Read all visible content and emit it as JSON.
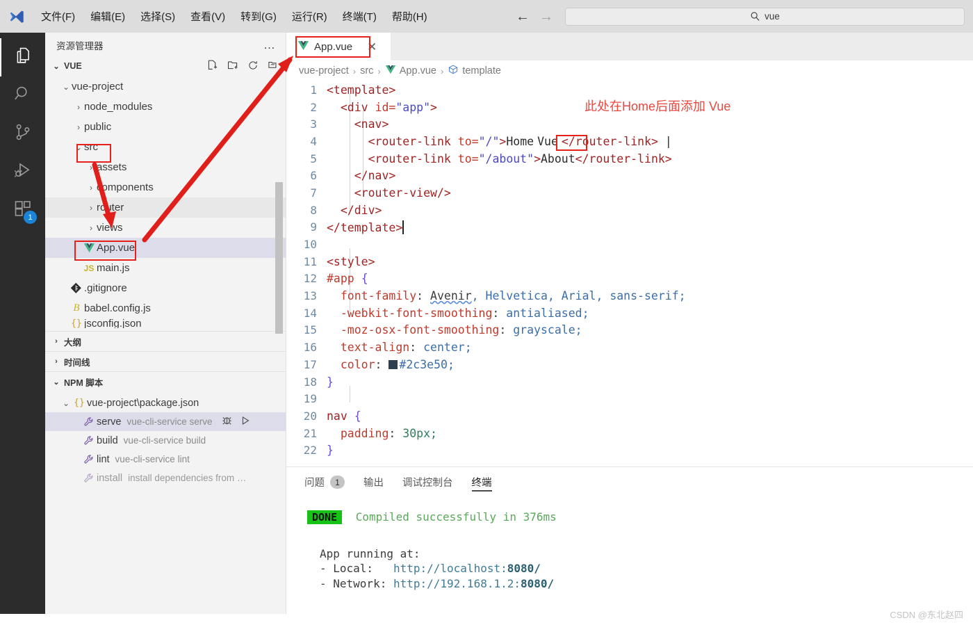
{
  "titlebar": {
    "logo_icon": "vscode-logo-icon",
    "menus": [
      "文件(F)",
      "编辑(E)",
      "选择(S)",
      "查看(V)",
      "转到(G)",
      "运行(R)",
      "终端(T)",
      "帮助(H)"
    ],
    "back_icon": "arrow-left-icon",
    "forward_icon": "arrow-right-icon",
    "search": {
      "icon": "search-icon",
      "value": "vue",
      "placeholder": "vue"
    }
  },
  "activitybar": {
    "items": [
      {
        "name": "explorer",
        "icon": "files-icon",
        "active": true,
        "badge": ""
      },
      {
        "name": "search",
        "icon": "search-icon",
        "active": false,
        "badge": ""
      },
      {
        "name": "source-control",
        "icon": "source-control-icon",
        "active": false,
        "badge": ""
      },
      {
        "name": "run-debug",
        "icon": "run-debug-icon",
        "active": false,
        "badge": ""
      },
      {
        "name": "extensions",
        "icon": "extensions-icon",
        "active": false,
        "badge": "1"
      }
    ]
  },
  "sidebar": {
    "title": "资源管理器",
    "more_actions": "…",
    "root": {
      "label": "VUE",
      "chevron": "⌄",
      "toolbar": [
        "new-file-icon",
        "new-folder-icon",
        "refresh-icon",
        "collapse-all-icon"
      ]
    },
    "tree": [
      {
        "label": "vue-project",
        "arrow": "⌄",
        "icon": "",
        "indent": 1,
        "state": "normal"
      },
      {
        "label": "node_modules",
        "arrow": "›",
        "icon": "",
        "indent": 2,
        "state": "normal"
      },
      {
        "label": "public",
        "arrow": "›",
        "icon": "",
        "indent": 2,
        "state": "normal"
      },
      {
        "label": "src",
        "arrow": "⌄",
        "icon": "",
        "indent": 2,
        "state": "normal"
      },
      {
        "label": "assets",
        "arrow": "›",
        "icon": "",
        "indent": 3,
        "state": "normal"
      },
      {
        "label": "components",
        "arrow": "›",
        "icon": "",
        "indent": 3,
        "state": "normal"
      },
      {
        "label": "router",
        "arrow": "›",
        "icon": "",
        "indent": 3,
        "state": "hovered"
      },
      {
        "label": "views",
        "arrow": "›",
        "icon": "",
        "indent": 3,
        "state": "normal"
      },
      {
        "label": "App.vue",
        "arrow": "",
        "icon": "vue-file-icon",
        "indent": 3,
        "state": "selected"
      },
      {
        "label": "main.js",
        "arrow": "",
        "icon": "js-file-icon",
        "indent": 3,
        "state": "normal"
      },
      {
        "label": ".gitignore",
        "arrow": "",
        "icon": "git-file-icon",
        "indent": 2,
        "state": "normal"
      },
      {
        "label": "babel.config.js",
        "arrow": "",
        "icon": "babel-file-icon",
        "indent": 2,
        "state": "normal"
      },
      {
        "label": "jsconfig.json",
        "arrow": "",
        "icon": "json-file-icon",
        "indent": 2,
        "state": "normal"
      }
    ],
    "panes": [
      {
        "label": "大纲",
        "chevron": "›"
      },
      {
        "label": "时间线",
        "chevron": "›"
      }
    ],
    "npm": {
      "label": "NPM 脚本",
      "chevron": "⌄",
      "package": {
        "label": "vue-project\\package.json",
        "chevron": "⌄",
        "icon": "json-braces-icon"
      },
      "scripts": [
        {
          "name": "serve",
          "command": "vue-cli-service serve",
          "icon": "wrench-icon",
          "selected": true,
          "actions": [
            "debug-icon",
            "run-icon"
          ]
        },
        {
          "name": "build",
          "command": "vue-cli-service build",
          "icon": "wrench-icon",
          "selected": false,
          "actions": []
        },
        {
          "name": "lint",
          "command": "vue-cli-service lint",
          "icon": "wrench-icon",
          "selected": false,
          "actions": []
        },
        {
          "name": "install",
          "command": "install dependencies from …",
          "icon": "wrench-icon",
          "selected": false,
          "actions": []
        }
      ]
    }
  },
  "editor": {
    "tab": {
      "label": "App.vue",
      "icon": "vue-file-icon",
      "close_icon": "close-icon"
    },
    "breadcrumbs": [
      {
        "label": "vue-project",
        "icon": ""
      },
      {
        "label": "src",
        "icon": ""
      },
      {
        "label": "App.vue",
        "icon": "vue-file-icon"
      },
      {
        "label": "template",
        "icon": "symbol-template-icon"
      }
    ],
    "breadcrumb_separator": "›",
    "lines": [
      {
        "n": "1",
        "indent": 0
      },
      {
        "n": "2",
        "indent": 0
      },
      {
        "n": "3",
        "indent": 0
      },
      {
        "n": "4",
        "indent": 0
      },
      {
        "n": "5",
        "indent": 0
      },
      {
        "n": "6",
        "indent": 0
      },
      {
        "n": "7",
        "indent": 0
      },
      {
        "n": "8",
        "indent": 0
      },
      {
        "n": "9",
        "indent": 0
      },
      {
        "n": "10",
        "indent": 0
      },
      {
        "n": "11",
        "indent": 0
      },
      {
        "n": "12",
        "indent": 0
      },
      {
        "n": "13",
        "indent": 0
      },
      {
        "n": "14",
        "indent": 0
      },
      {
        "n": "15",
        "indent": 0
      },
      {
        "n": "16",
        "indent": 0
      },
      {
        "n": "17",
        "indent": 0
      },
      {
        "n": "18",
        "indent": 0
      },
      {
        "n": "19",
        "indent": 0
      },
      {
        "n": "20",
        "indent": 0
      },
      {
        "n": "21",
        "indent": 0
      },
      {
        "n": "22",
        "indent": 0
      }
    ],
    "code": {
      "l1": "<template>",
      "l2": "  <div id=\"app\">",
      "l3": "    <nav>",
      "l4": "      <router-link to=\"/\">Home Vue</router-link> |",
      "l5": "      <router-link to=\"/about\">About</router-link>",
      "l6": "    </nav>",
      "l7": "    <router-view/>",
      "l8": "  </div>",
      "l9": "</template>",
      "l11": "<style>",
      "l12": "#app {",
      "l13": "  font-family: Avenir, Helvetica, Arial, sans-serif;",
      "l14": "  -webkit-font-smoothing: antialiased;",
      "l15": "  -moz-osx-font-smoothing: grayscale;",
      "l16": "  text-align: center;",
      "l17": "  color: #2c3e50;",
      "l18": "}",
      "l20": "nav {",
      "l21": "  padding: 30px;",
      "l22": "}",
      "tokens": {
        "template_open": "<template>",
        "template_close": "</template>",
        "div_open": "<div",
        "attr_id": "id=",
        "val_app": "\"app\"",
        "gt": ">",
        "nav_open": "<nav>",
        "nav_close": "</nav>",
        "div_close": "</div>",
        "router_link_open": "<router-link",
        "attr_to": "to=",
        "val_slash": "\"/\"",
        "val_about": "\"/about\"",
        "text_home": "Home",
        "text_vue": "Vue",
        "text_about": "About",
        "router_link_close": "</router-link>",
        "pipe": "|",
        "router_view": "<router-view/>",
        "style_open": "<style>",
        "sel_app": "#app",
        "brace_open": "{",
        "brace_close": "}",
        "p_fontfamily": "font-family",
        "v_avenir": "Avenir",
        "v_fontrest": ", Helvetica, Arial, sans-serif;",
        "p_webkit": "-webkit-font-smoothing",
        "v_antialiased": "antialiased;",
        "p_moz": "-moz-osx-font-smoothing",
        "v_grayscale": "grayscale;",
        "p_textalign": "text-align",
        "v_center": "center;",
        "p_color": "color",
        "v_hex": "#2c3e50;",
        "sel_nav": "nav",
        "p_padding": "padding",
        "v_30px": "30px;",
        "colon": ":"
      },
      "color_swatch": "#2c3e50"
    }
  },
  "panel": {
    "tabs": [
      {
        "label": "问题",
        "badge": "1",
        "active": false
      },
      {
        "label": "输出",
        "badge": "",
        "active": false
      },
      {
        "label": "调试控制台",
        "badge": "",
        "active": false
      },
      {
        "label": "终端",
        "badge": "",
        "active": true
      }
    ],
    "terminal": {
      "status_badge": "DONE",
      "status_message": "Compiled successfully in 376ms",
      "running_title": "App running at:",
      "local_label": "- Local:   ",
      "local_url_base": "http://localhost:",
      "local_port": "8080/",
      "network_label": "- Network: ",
      "network_url_base": "http://192.168.1.2:",
      "network_port": "8080/"
    }
  },
  "annotations": {
    "note": "此处在Home后面添加 Vue",
    "note_color": "#e8473f",
    "box_color": "#e8201a",
    "arrow_color": "#e01f1a"
  },
  "watermark": "CSDN @东北赵四"
}
